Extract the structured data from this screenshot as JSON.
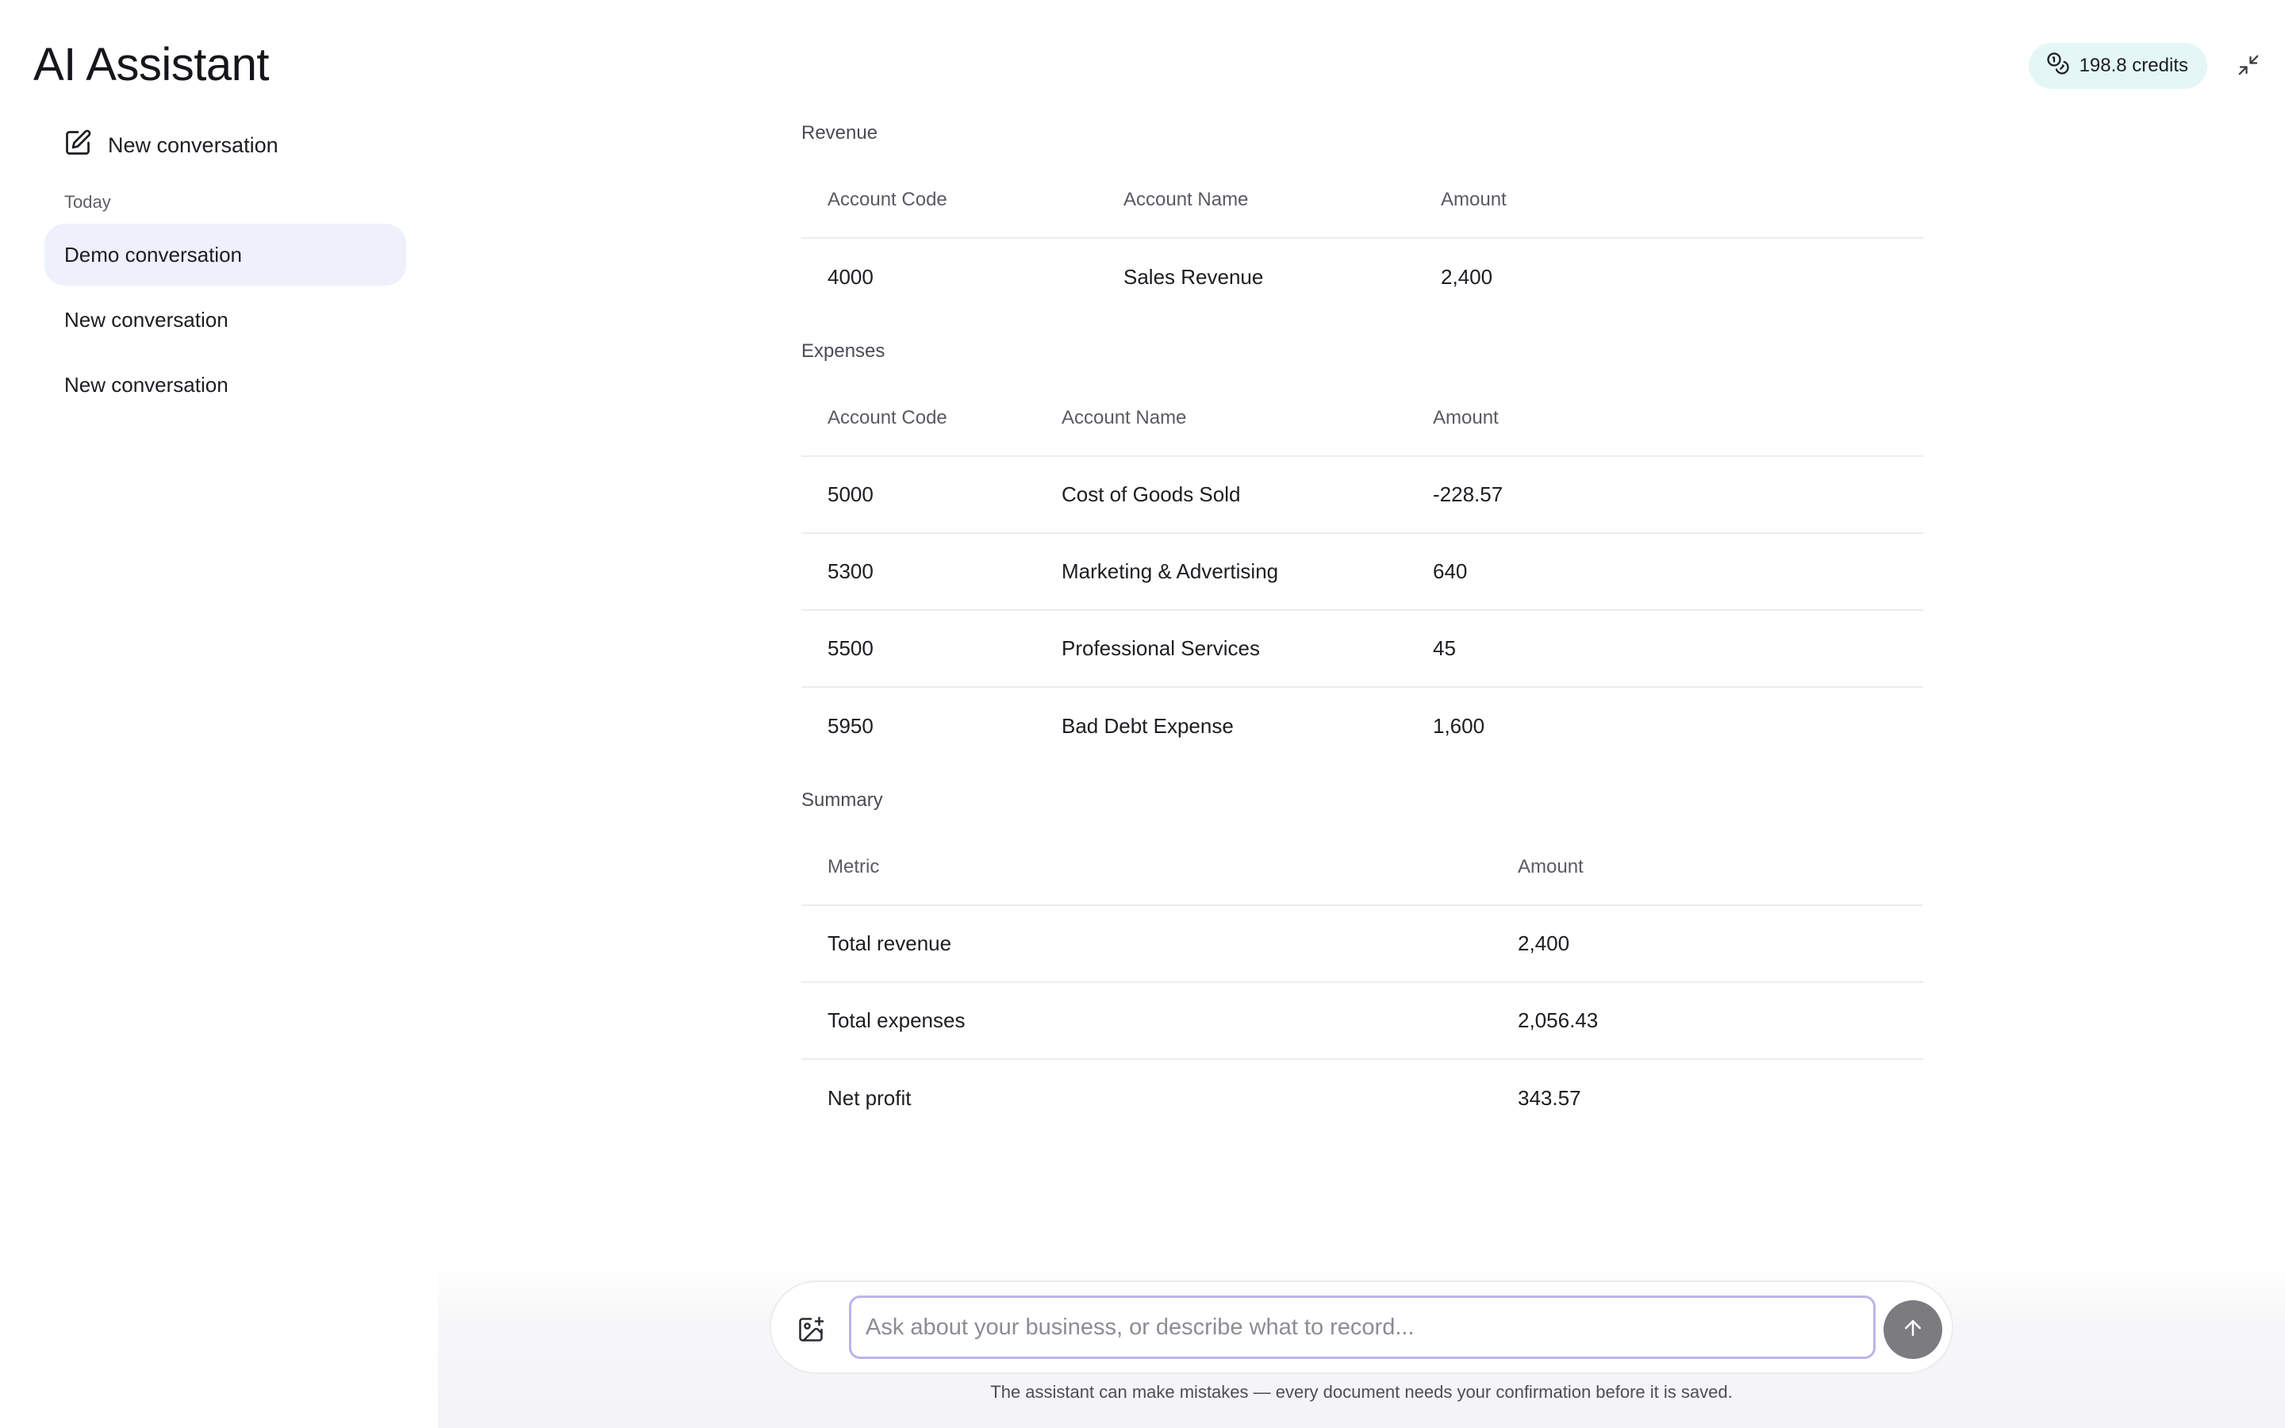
{
  "app": {
    "title": "AI Assistant"
  },
  "header": {
    "credits": "198.8 credits"
  },
  "sidebar": {
    "new_conversation": "New conversation",
    "section_label": "Today",
    "items": [
      {
        "label": "Demo conversation",
        "active": true
      },
      {
        "label": "New conversation",
        "active": false
      },
      {
        "label": "New conversation",
        "active": false
      }
    ]
  },
  "report": {
    "revenue": {
      "title": "Revenue",
      "headers": [
        "Account Code",
        "Account Name",
        "Amount"
      ],
      "rows": [
        [
          "4000",
          "Sales Revenue",
          "2,400"
        ]
      ]
    },
    "expenses": {
      "title": "Expenses",
      "headers": [
        "Account Code",
        "Account Name",
        "Amount"
      ],
      "rows": [
        [
          "5000",
          "Cost of Goods Sold",
          "-228.57"
        ],
        [
          "5300",
          "Marketing & Advertising",
          "640"
        ],
        [
          "5500",
          "Professional Services",
          "45"
        ],
        [
          "5950",
          "Bad Debt Expense",
          "1,600"
        ]
      ]
    },
    "summary": {
      "title": "Summary",
      "headers": [
        "Metric",
        "Amount"
      ],
      "rows": [
        [
          "Total revenue",
          "2,400"
        ],
        [
          "Total expenses",
          "2,056.43"
        ],
        [
          "Net profit",
          "343.57"
        ]
      ]
    }
  },
  "composer": {
    "value": "",
    "placeholder": "Ask about your business, or describe what to record...",
    "disclaimer": "The assistant can make mistakes — every document needs your confirmation before it is saved."
  },
  "icons": {
    "credits": "coins-icon",
    "collapse": "collapse-icon",
    "new_conversation": "edit-icon",
    "attach": "image-plus-icon",
    "send": "arrow-up-icon"
  },
  "colors": {
    "credits_bg": "#e4f7f6",
    "active_conversation_bg": "#eef0fc",
    "input_border": "#b9b6ea",
    "send_button": "#7c7c80"
  }
}
